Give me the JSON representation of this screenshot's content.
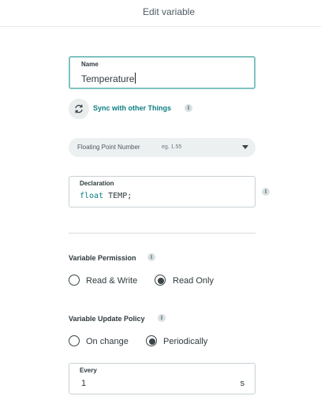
{
  "header": {
    "title": "Edit variable"
  },
  "name_field": {
    "label": "Name",
    "value": "Temperature"
  },
  "sync": {
    "label": "Sync with other Things",
    "info": "i"
  },
  "type_select": {
    "value": "Floating Point Number",
    "hint": "eg. 1.55"
  },
  "declaration": {
    "label": "Declaration",
    "keyword": "float",
    "rest": " TEMP;",
    "info": "i"
  },
  "permission": {
    "title": "Variable Permission",
    "info": "i",
    "options": [
      {
        "label": "Read & Write",
        "checked": false
      },
      {
        "label": "Read Only",
        "checked": true
      }
    ]
  },
  "update_policy": {
    "title": "Variable Update Policy",
    "info": "i",
    "options": [
      {
        "label": "On change",
        "checked": false
      },
      {
        "label": "Periodically",
        "checked": true
      }
    ]
  },
  "every": {
    "label": "Every",
    "value": "1",
    "unit": "s"
  },
  "colors": {
    "accent": "#0c7d82",
    "focus_border": "#7fc3c1",
    "text": "#2f3a3d"
  }
}
